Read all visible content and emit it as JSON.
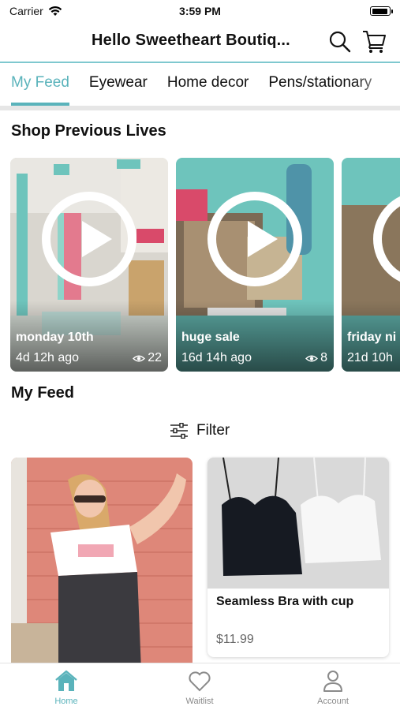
{
  "status_bar": {
    "carrier": "Carrier",
    "time": "3:59 PM"
  },
  "header": {
    "title": "Hello Sweetheart Boutiq...",
    "search_icon": "search-icon",
    "cart_icon": "cart-icon"
  },
  "tabs": [
    {
      "label": "My Feed",
      "active": true
    },
    {
      "label": "Eyewear",
      "active": false
    },
    {
      "label": "Home decor",
      "active": false
    },
    {
      "label": "Pens/stationary",
      "active": false
    }
  ],
  "previous_lives": {
    "title": "Shop Previous Lives",
    "items": [
      {
        "name": "monday 10th",
        "ago": "4d 12h ago",
        "views": "22"
      },
      {
        "name": "huge sale",
        "ago": "16d 14h ago",
        "views": "8"
      },
      {
        "name": "friday ni",
        "ago": "21d 10h"
      }
    ]
  },
  "feed": {
    "title": "My Feed",
    "filter_label": "Filter",
    "products": [
      {
        "name": "",
        "price": ""
      },
      {
        "name": "Seamless Bra with cup",
        "price": "$11.99"
      }
    ]
  },
  "bottom_nav": [
    {
      "label": "Home",
      "icon": "home-icon",
      "active": true
    },
    {
      "label": "Waitlist",
      "icon": "heart-icon",
      "active": false
    },
    {
      "label": "Account",
      "icon": "person-icon",
      "active": false
    }
  ],
  "colors": {
    "accent": "#5ab3bb",
    "header_rule": "#7fc8cf",
    "teal_backdrop": "#6ec4bc"
  }
}
